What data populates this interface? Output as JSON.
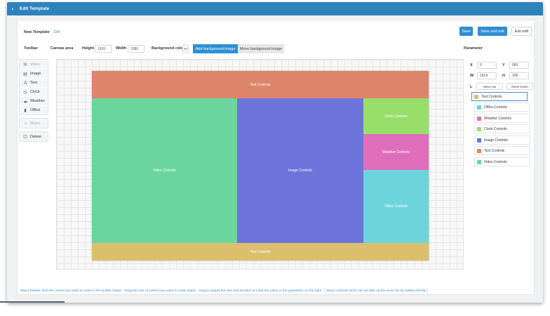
{
  "topbar": {
    "title": "Edit Template",
    "back_icon": "chevron-left-icon"
  },
  "header": {
    "template_name": "New Template",
    "edit_link": "Edit",
    "save_label": "Save",
    "save_exit_label": "Save and exit",
    "exit_label": "Exit edit"
  },
  "settings": {
    "toolbar_label": "Toolbar",
    "canvas_area_label": "Canvas area",
    "height_label": "Height",
    "height_value": "1920",
    "width_label": "Width",
    "width_value": "1080",
    "bgcolor_label": "Background color",
    "bgcolor_value": "#0",
    "add_bg_label": "Add background image",
    "move_bg_label": "Move background image",
    "parameter_label": "Parameter"
  },
  "toolbar": {
    "items": [
      {
        "label": "Video",
        "icon": "video-icon",
        "disabled": true
      },
      {
        "label": "Image",
        "icon": "image-icon",
        "disabled": false
      },
      {
        "label": "Text",
        "icon": "text-icon",
        "disabled": false
      },
      {
        "label": "Clock",
        "icon": "clock-icon",
        "disabled": false
      },
      {
        "label": "Weather",
        "icon": "cloud-icon",
        "disabled": false
      },
      {
        "label": "Office",
        "icon": "document-icon",
        "disabled": false
      }
    ],
    "music": {
      "label": "Music",
      "icon": "music-icon",
      "disabled": true
    },
    "delete": {
      "label": "Delete",
      "icon": "trash-icon"
    }
  },
  "canvas_blocks": {
    "top_text": {
      "label": "Text Controls",
      "color": "#dd856b"
    },
    "video": {
      "label": "Video Controls",
      "color": "#6ad69e"
    },
    "image": {
      "label": "Image Controls",
      "color": "#6c74dc"
    },
    "clock": {
      "label": "Clock Controls",
      "color": "#97de6b"
    },
    "weather": {
      "label": "Weather Controls",
      "color": "#df6eba"
    },
    "office": {
      "label": "Office Controls",
      "color": "#6cd5dc"
    },
    "bottom_text": {
      "label": "Text Controls",
      "color": "#dcbf6c"
    }
  },
  "parameters": {
    "x_label": "X",
    "x_value": "0",
    "y_label": "Y",
    "y_value": "960",
    "w_label": "W",
    "w_value": "1919",
    "h_label": "H",
    "h_value": "100",
    "l_label": "L",
    "move_up": "Move Up",
    "move_down": "Move Down"
  },
  "layers": [
    {
      "label": "Text Controls",
      "color": "#dcbf6c",
      "selected": true
    },
    {
      "label": "Office Controls",
      "color": "#6cd5dc",
      "selected": false
    },
    {
      "label": "Weather Controls",
      "color": "#df6eba",
      "selected": false
    },
    {
      "label": "Clock Controls",
      "color": "#97de6b",
      "selected": false
    },
    {
      "label": "Image Controls",
      "color": "#6c74dc",
      "selected": false
    },
    {
      "label": "Text Controls",
      "color": "#dd856b",
      "selected": false
    },
    {
      "label": "Video Controls",
      "color": "#6ad69e",
      "selected": false
    }
  ],
  "footer": {
    "steps": "Step1:Please click the control you want to creat in the toolbar  Step2：Drag the size of control you want to creat  Step3：Drag to adjust the size and location or input the value in the parameter on the right  （ Music controls which do not take up the area can be added directly ）"
  }
}
